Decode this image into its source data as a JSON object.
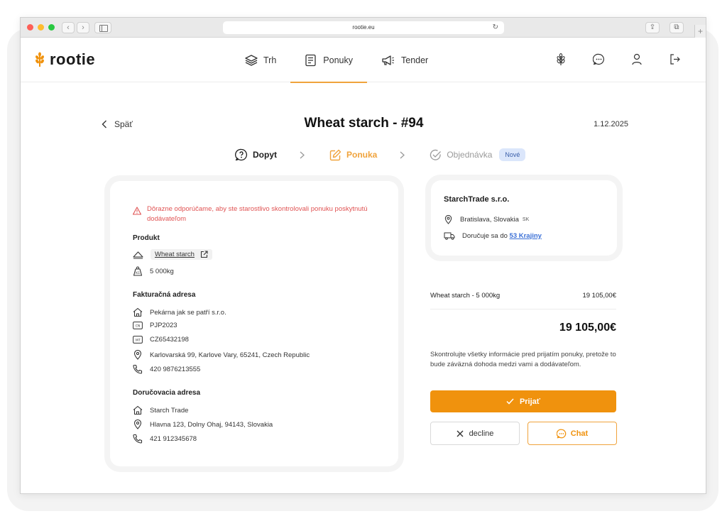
{
  "browser": {
    "url": "rootie.eu"
  },
  "header": {
    "logo_text": "rootie",
    "nav": [
      {
        "label": "Trh"
      },
      {
        "label": "Ponuky"
      },
      {
        "label": "Tender"
      }
    ]
  },
  "page": {
    "back_label": "Späť",
    "title": "Wheat starch - #94",
    "date": "1.12.2025"
  },
  "steps": [
    {
      "label": "Dopyt"
    },
    {
      "label": "Ponuka"
    },
    {
      "label": "Objednávka"
    }
  ],
  "status_badge": "Nové",
  "offer": {
    "warning": "Dôrazne odporúčame, aby ste starostlivo skontrolovali ponuku poskytnutú dodávateľom",
    "product_title": "Produkt",
    "product_name": "Wheat starch",
    "quantity": "5 000kg",
    "billing_title": "Fakturačná adresa",
    "billing_company": "Pekárna jak se patří s.r.o.",
    "billing_cn": "PJP2023",
    "billing_vat": "CZ65432198",
    "billing_address": "Karlovarská 99, Karlove Vary, 65241, Czech Republic",
    "billing_phone": "420 9876213555",
    "delivery_title": "Doručovacia adresa",
    "delivery_name": "Starch Trade",
    "delivery_address": "Hlavna 123, Dolny Ohaj, 94143, Slovakia",
    "delivery_phone": "421 912345678"
  },
  "seller": {
    "name": "StarchTrade s.r.o.",
    "location": "Bratislava, Slovakia",
    "country_code": "SK",
    "delivers_prefix": "Doručuje sa do",
    "delivers_link": "53 Krajiny"
  },
  "summary": {
    "line_label": "Wheat starch - 5 000kg",
    "line_amount": "19 105,00€",
    "total": "19 105,00€",
    "notice": "Skontrolujte všetky informácie pred prijatím ponuky, pretože to bude záväzná dohoda medzi vami a dodávateľom."
  },
  "actions": {
    "accept": "Prijať",
    "decline": "decline",
    "chat": "Chat"
  },
  "colors": {
    "accent": "#f0920d",
    "warning": "#e05353",
    "link": "#3a6fd6",
    "badge_bg": "#dbe6fb"
  }
}
